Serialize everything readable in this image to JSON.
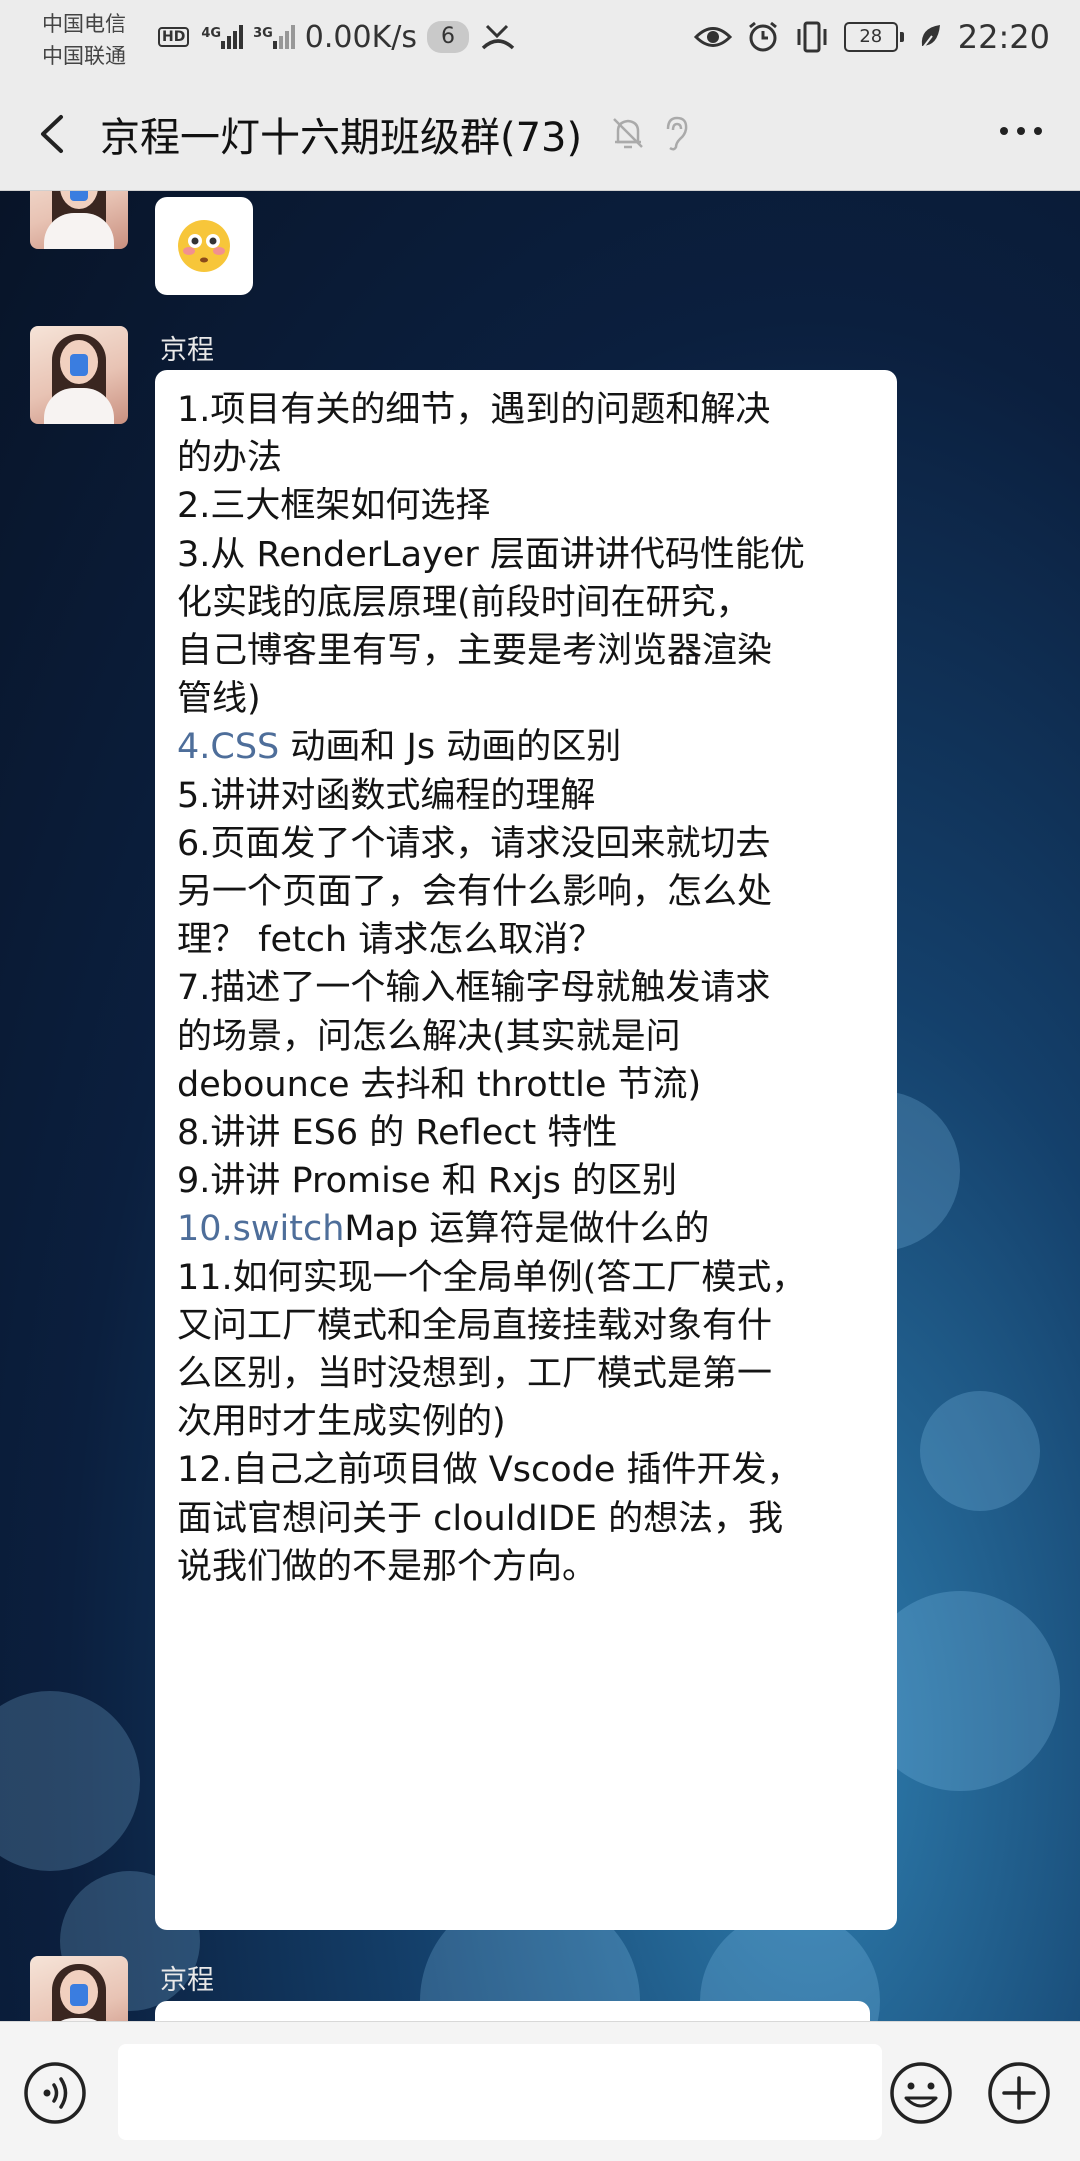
{
  "status_bar": {
    "carrier_1": "中国电信",
    "carrier_2": "中国联通",
    "hd": "HD",
    "net_1": "4G",
    "net_2": "3G",
    "speed": "0.00K/s",
    "notification_count": "6",
    "battery": "28",
    "time": "22:20"
  },
  "header": {
    "title": "京程一灯十六期班级群(73)"
  },
  "messages": [
    {
      "type": "emoji"
    },
    {
      "sender": "京程",
      "lines": [
        {
          "text": "1.项目有关的细节，遇到的问题和解决"
        },
        {
          "text": "的办法"
        },
        {
          "text": "2.三大框架如何选择"
        },
        {
          "text": "3.从 RenderLayer 层面讲讲代码性能优"
        },
        {
          "text": "化实践的底层原理(前段时间在研究，"
        },
        {
          "text": "自己博客里有写，主要是考浏览器渲染"
        },
        {
          "text": "管线)"
        },
        {
          "link": "4.CSS",
          "text": " 动画和 Js 动画的区别"
        },
        {
          "text": "5.讲讲对函数式编程的理解"
        },
        {
          "text": "6.页面发了个请求，请求没回来就切去"
        },
        {
          "text": "另一个页面了，会有什么影响，怎么处"
        },
        {
          "text": "理？ fetch 请求怎么取消？"
        },
        {
          "text": "7.描述了一个输入框输字母就触发请求"
        },
        {
          "text": "的场景，问怎么解决(其实就是问"
        },
        {
          "text": "debounce 去抖和 throttle 节流)"
        },
        {
          "text": "8.讲讲 ES6 的 Reflect 特性"
        },
        {
          "text": "9.讲讲 Promise 和 Rxjs 的区别"
        },
        {
          "link": "10.switch",
          "text": "Map 运算符是做什么的"
        },
        {
          "text": "11.如何实现一个全局单例(答工厂模式，"
        },
        {
          "text": "又问工厂模式和全局直接挂载对象有什"
        },
        {
          "text": "么区别，当时没想到，工厂模式是第一"
        },
        {
          "text": "次用时才生成实例的)"
        },
        {
          "text": "12.自己之前项目做 Vscode 插件开发，"
        },
        {
          "text": "面试官想问关于 clouldIDE 的想法，我"
        },
        {
          "text": "说我们做的不是那个方向。"
        }
      ]
    },
    {
      "sender": "京程"
    }
  ]
}
